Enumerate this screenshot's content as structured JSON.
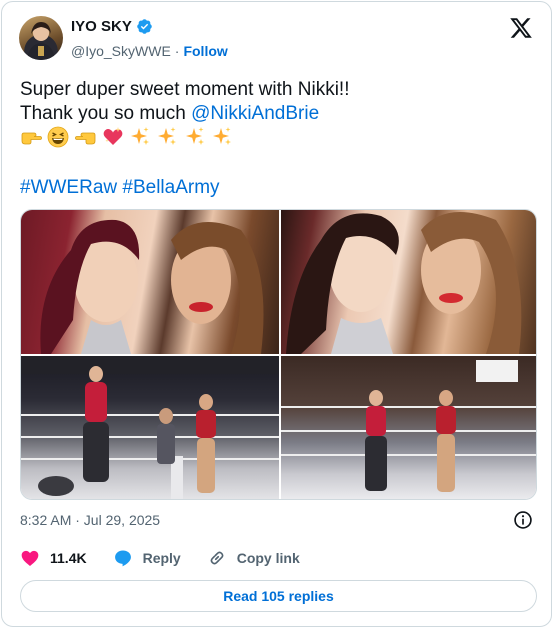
{
  "author": {
    "display_name": "IYO SKY",
    "handle": "@Iyo_SkyWWE",
    "separator": "·",
    "follow_label": "Follow"
  },
  "tweet": {
    "line1": "Super duper sweet moment with Nikki!!",
    "line2_prefix": "Thank you so much ",
    "mention": "@NikkiAndBrie",
    "emojis": [
      "point-right-emoji",
      "grinning-squinting-emoji",
      "point-left-emoji",
      "sparkling-heart-emoji",
      "sparkles-emoji",
      "sparkles-emoji",
      "sparkles-emoji",
      "sparkles-emoji"
    ],
    "hashtags": [
      "#WWERaw",
      "#BellaArmy"
    ]
  },
  "timestamp": "8:32 AM · Jul 29, 2025",
  "actions": {
    "like_count": "11.4K",
    "reply_label": "Reply",
    "copy_label": "Copy link"
  },
  "read_replies_label": "Read 105 replies",
  "colors": {
    "accent": "#006fd6",
    "verified": "#1d9bf0",
    "like": "#f91880",
    "reply": "#1d9bf0",
    "border": "#cfd9de",
    "secondary": "#536471"
  }
}
